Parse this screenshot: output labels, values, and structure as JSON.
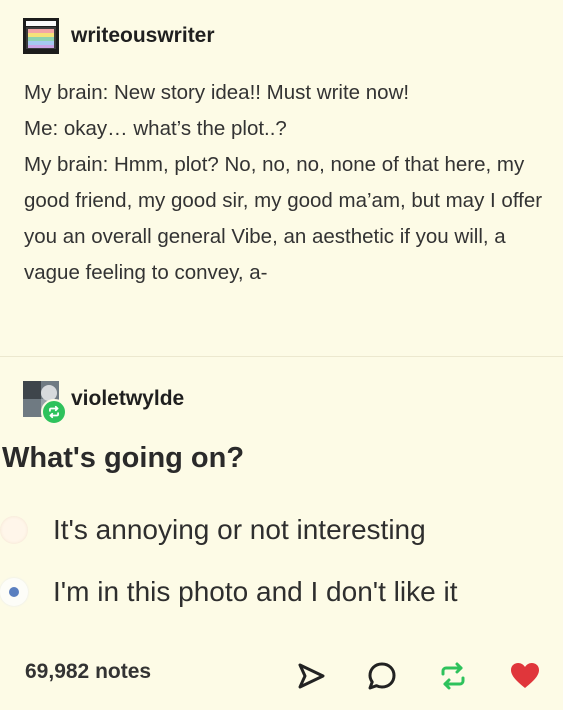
{
  "post1": {
    "username": "writeouswriter",
    "lines": [
      "My brain: New story idea!! Must write now!",
      "Me: okay… what’s the plot..?",
      "My brain: Hmm, plot? No, no, no, none of that here, my good friend, my good sir, my good ma’am, but may I offer you an overall general Vibe, an aesthetic if you will, a vague feeling to convey, a-"
    ]
  },
  "post2": {
    "username": "violetwylde",
    "poll": {
      "question": "What's going on?",
      "options": [
        {
          "label": "It's annoying or not interesting",
          "selected": false
        },
        {
          "label": "I'm in this photo and I don't like it",
          "selected": true
        }
      ]
    }
  },
  "footer": {
    "notes": "69,982 notes",
    "icons": [
      "share-icon",
      "reply-icon",
      "reblog-icon",
      "like-icon"
    ]
  },
  "colors": {
    "background": "#fdfbe6",
    "reblog_badge": "#2ec25c",
    "like": "#e0363b",
    "radio_selected": "#5a7fbf"
  }
}
